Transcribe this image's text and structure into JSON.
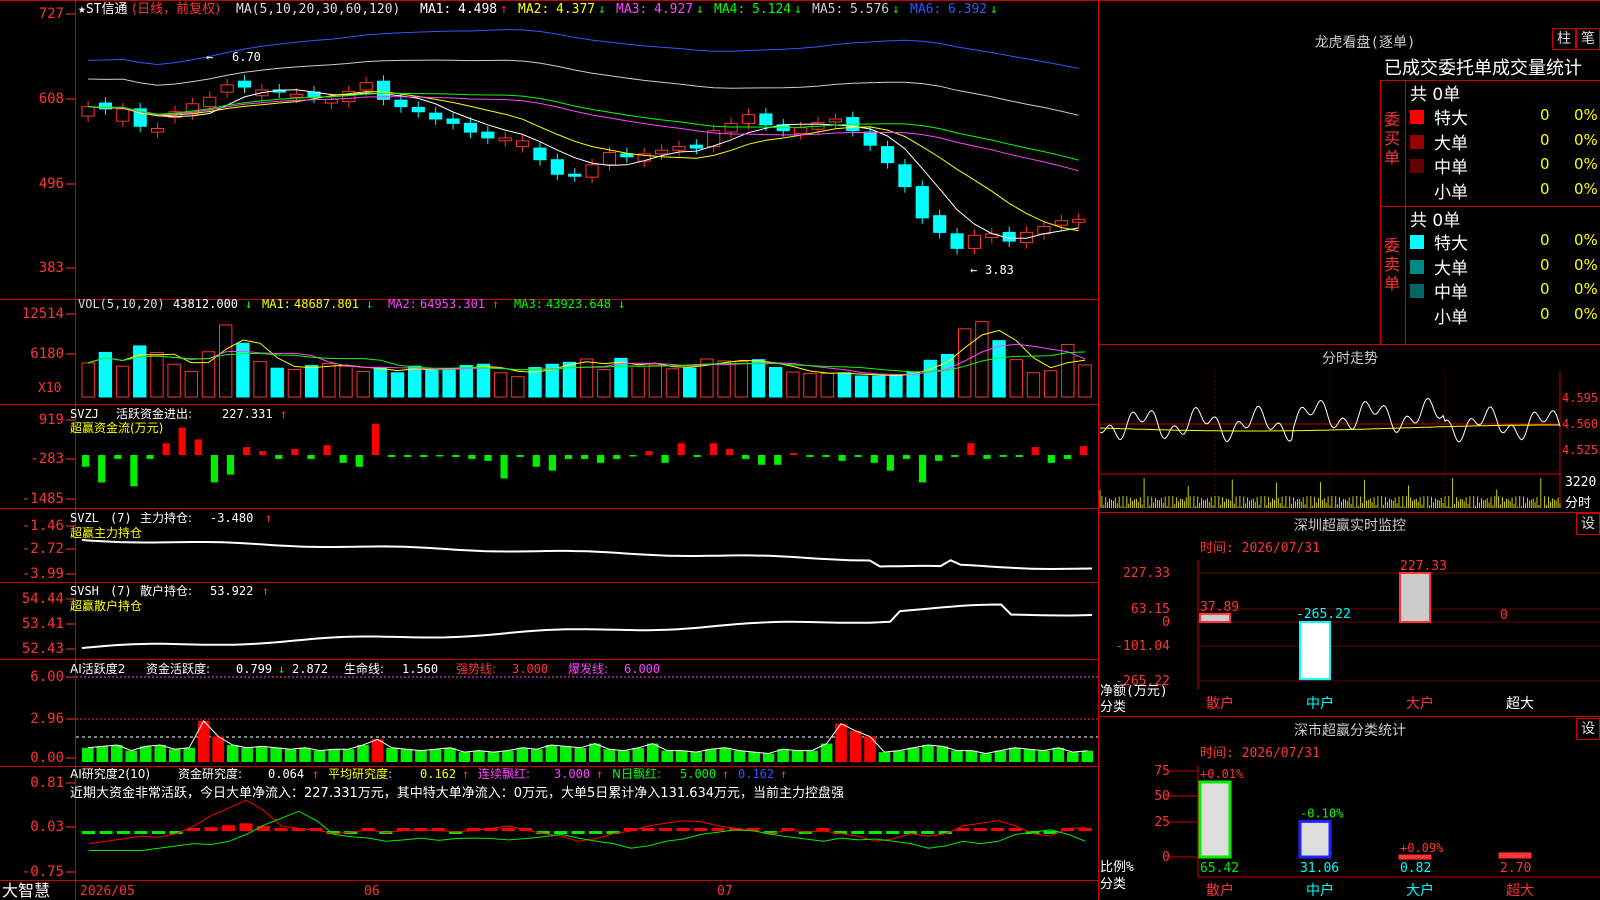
{
  "stock": {
    "name": "★ST信通",
    "period": "(日线，前复权)",
    "ma_label": "MA(5,10,20,30,60,120)",
    "ma": [
      {
        "label": "MA1:",
        "value": "4.498",
        "arrow": "↑",
        "color": "#ffffff"
      },
      {
        "label": "MA2:",
        "value": "4.377",
        "arrow": "↓",
        "color": "#ffff00"
      },
      {
        "label": "MA3:",
        "value": "4.927",
        "arrow": "↓",
        "color": "#ff44ff"
      },
      {
        "label": "MA4:",
        "value": "5.124",
        "arrow": "↓",
        "color": "#00ff00"
      },
      {
        "label": "MA5:",
        "value": "5.576",
        "arrow": "↓",
        "color": "#cccccc"
      },
      {
        "label": "MA6:",
        "value": "6.392",
        "arrow": "↓",
        "color": "#3355ff"
      }
    ],
    "price_ticks": [
      "727",
      "608",
      "496",
      "383"
    ],
    "high_label": "6.70",
    "low_label": "3.83",
    "candles_close": [
      6.05,
      6.02,
      6.02,
      5.78,
      5.75,
      5.98,
      6.09,
      6.18,
      6.35,
      6.32,
      6.28,
      6.25,
      6.22,
      6.18,
      6.15,
      6.26,
      6.38,
      6.15,
      6.05,
      5.98,
      5.88,
      5.82,
      5.7,
      5.62,
      5.62,
      5.58,
      5.32,
      5.12,
      5.1,
      5.25,
      5.42,
      5.36,
      5.4,
      5.45,
      5.5,
      5.48,
      5.72,
      5.82,
      5.94,
      5.8,
      5.72,
      5.76,
      5.83,
      5.88,
      5.72,
      5.52,
      5.28,
      4.95,
      4.52,
      4.32,
      4.1,
      4.28,
      4.3,
      4.2,
      4.32,
      4.4,
      4.48,
      4.5
    ],
    "candles_open": [
      5.92,
      6.1,
      5.85,
      6.02,
      5.7,
      5.9,
      5.95,
      6.05,
      6.25,
      6.4,
      6.2,
      6.28,
      6.18,
      6.25,
      6.1,
      6.12,
      6.28,
      6.4,
      6.14,
      6.04,
      5.96,
      5.88,
      5.82,
      5.7,
      5.58,
      5.5,
      5.48,
      5.32,
      5.12,
      5.08,
      5.25,
      5.4,
      5.3,
      5.4,
      5.45,
      5.52,
      5.5,
      5.7,
      5.82,
      5.95,
      5.8,
      5.68,
      5.74,
      5.84,
      5.9,
      5.7,
      5.5,
      5.25,
      4.95,
      4.55,
      4.3,
      4.1,
      4.25,
      4.32,
      4.18,
      4.3,
      4.42,
      4.46
    ]
  },
  "volume": {
    "label": "VOL(5,10,20)",
    "value": "43812.000",
    "arrow": "↓",
    "ma": [
      {
        "label": "MA1:",
        "value": "48687.801",
        "arrow": "↓",
        "color": "#ffff00"
      },
      {
        "label": "MA2:",
        "value": "64953.301",
        "arrow": "↑",
        "color": "#ff44ff"
      },
      {
        "label": "MA3:",
        "value": "43923.648",
        "arrow": "↓",
        "color": "#00ff00"
      }
    ],
    "ticks": [
      "12514",
      "6180"
    ],
    "unit": "X10",
    "bars": [
      5200,
      6800,
      4700,
      7800,
      6800,
      5000,
      3900,
      6900,
      11000,
      8200,
      5400,
      4400,
      4200,
      4800,
      5100,
      4700,
      3900,
      4500,
      3700,
      4700,
      4100,
      4200,
      4800,
      5000,
      3700,
      3100,
      4500,
      5000,
      5300,
      5800,
      4200,
      5900,
      4700,
      4900,
      4300,
      4400,
      5800,
      5500,
      5400,
      5700,
      4500,
      3800,
      3600,
      3600,
      3700,
      3200,
      3200,
      3400,
      3800,
      5600,
      6500,
      10400,
      11500,
      8600,
      5700,
      3700,
      4000,
      8000,
      4900
    ]
  },
  "svzj": {
    "title": "SVZJ",
    "desc": "活跃资金进出:",
    "value": "227.331",
    "arrow": "↑",
    "sub": "超赢资金流(万元)",
    "ticks": [
      "919",
      "-283",
      "-1485"
    ],
    "values": [
      -300,
      -700,
      -100,
      -800,
      -100,
      300,
      700,
      400,
      -700,
      -500,
      200,
      100,
      -100,
      150,
      -100,
      250,
      -200,
      -300,
      800,
      -50,
      -50,
      -50,
      -20,
      -50,
      -100,
      -150,
      -600,
      -50,
      -300,
      -400,
      -100,
      -100,
      -200,
      -100,
      -20,
      100,
      -200,
      300,
      -50,
      300,
      150,
      -100,
      -250,
      -250,
      50,
      -50,
      -50,
      -150,
      -50,
      -200,
      -400,
      -100,
      -700,
      -150,
      -50,
      300,
      -100,
      -50,
      -50,
      200,
      -200,
      -100,
      227
    ]
  },
  "svzl": {
    "title": "SVZL",
    "param": "(7)",
    "desc": "主力持仓:",
    "value": "-3.480",
    "arrow": "↑",
    "sub": "超赢主力持仓",
    "ticks": [
      "-1.46",
      "-2.72",
      "-3.99"
    ]
  },
  "svsh": {
    "title": "SVSH",
    "param": "(7)",
    "desc": "散户持仓:",
    "value": "53.922",
    "arrow": "↑",
    "sub": "超赢散户持仓",
    "ticks": [
      "54.44",
      "53.41",
      "52.43"
    ]
  },
  "ai1": {
    "title": "AI活跃度2",
    "desc": "资金活跃度:",
    "v1": "0.799",
    "a1": "↓",
    "v2": "2.872",
    "life_label": "生命线:",
    "life": "1.560",
    "strong_label": "强势线:",
    "strong": "3.000",
    "burst_label": "爆发线:",
    "burst": "6.000",
    "ticks": [
      "6.00",
      "2.96",
      "0.00"
    ],
    "values": [
      1.0,
      1.1,
      1.2,
      0.8,
      1.1,
      1.2,
      0.9,
      1.0,
      2.9,
      1.8,
      1.2,
      1.0,
      1.1,
      1.0,
      0.9,
      1.0,
      0.8,
      0.9,
      0.9,
      1.2,
      1.6,
      1.0,
      0.9,
      0.8,
      0.9,
      1.0,
      0.7,
      0.8,
      0.7,
      0.8,
      1.0,
      0.9,
      1.2,
      1.1,
      1.0,
      1.3,
      0.9,
      0.8,
      1.0,
      1.3,
      0.8,
      0.8,
      0.7,
      0.9,
      1.0,
      0.8,
      0.7,
      0.6,
      0.9,
      0.8,
      0.8,
      1.3,
      2.7,
      2.2,
      1.8,
      0.7,
      0.8,
      1.0,
      1.2,
      1.1,
      0.8,
      0.8,
      0.6,
      0.8,
      1.0,
      0.9,
      0.8,
      1.0,
      0.7,
      0.799
    ]
  },
  "ai2": {
    "title": "AI研究度2(10)",
    "desc": "资金研究度:",
    "v1": "0.064",
    "a1": "↑",
    "avg_label": "平均研究度:",
    "avg": "0.162",
    "a2": "↑",
    "streak_label": "连续飘红:",
    "streak": "3.000",
    "a3": "↑",
    "nday_label": "N日飘红:",
    "nday": "5.000",
    "a4": "↑",
    "v5": "0.162",
    "a5": "↑",
    "summary": "近期大资金非常活跃，今日大单净流入：227.331万元，其中特大单净流入：0万元，大单5日累计净入131.634万元，当前主力控盘强",
    "ticks": [
      "0.81",
      "0.03",
      "-0.75"
    ],
    "values": [
      -0.25,
      -0.2,
      -0.15,
      -0.1,
      -0.12,
      -0.05,
      0.1,
      0.3,
      0.45,
      0.6,
      0.4,
      0.1,
      0.05,
      0.02,
      -0.05,
      -0.02,
      0.02,
      -0.03,
      0.01,
      0.02,
      0.01,
      -0.02,
      0.01,
      0.05,
      0.1,
      0.02,
      -0.05,
      -0.1,
      -0.2,
      -0.15,
      -0.05,
      0.0,
      0.1,
      0.15,
      0.2,
      0.18,
      0.1,
      0.05,
      0.0,
      -0.05,
      0.02,
      -0.02,
      0.0,
      -0.05,
      -0.1,
      -0.2,
      -0.15,
      -0.05,
      -0.1,
      -0.05,
      0.1,
      0.15,
      0.2,
      0.1,
      -0.05,
      -0.1,
      0.05,
      0.064
    ]
  },
  "xaxis": {
    "labels": [
      "2026/05",
      "06",
      "07"
    ]
  },
  "brand": "大智慧",
  "right": {
    "lhkp_title": "龙虎看盘(逐单)",
    "btn_zhu": "柱",
    "btn_bi": "笔",
    "order_header": "已成交委托单成交量统计",
    "buy_label": "委买单",
    "sell_label": "委卖单",
    "buy_total": "共 0单",
    "sell_total": "共 0单",
    "buy_rows": [
      {
        "name": "特大",
        "count": "0",
        "pct": "0%",
        "color": "#ff0000"
      },
      {
        "name": "大单",
        "count": "0",
        "pct": "0%",
        "color": "#990000"
      },
      {
        "name": "中单",
        "count": "0",
        "pct": "0%",
        "color": "#660000"
      },
      {
        "name": "小单",
        "count": "0",
        "pct": "0%",
        "color": ""
      }
    ],
    "sell_rows": [
      {
        "name": "特大",
        "count": "0",
        "pct": "0%",
        "color": "#00ffff"
      },
      {
        "name": "大单",
        "count": "0",
        "pct": "0%",
        "color": "#008888"
      },
      {
        "name": "中单",
        "count": "0",
        "pct": "0%",
        "color": "#006666"
      },
      {
        "name": "小单",
        "count": "0",
        "pct": "0%",
        "color": ""
      }
    ],
    "fs_title": "分时走势",
    "fs_ticks": [
      "4.595",
      "4.560",
      "4.525"
    ],
    "fs_vol": "3220",
    "fs_vol_label": "分时",
    "sz_title": "深圳超赢实时监控",
    "sz_btn": "设",
    "sz_time": "时间: 2026/07/31",
    "sz_ticks": [
      "227.33",
      "63.15",
      "0",
      "-101.04",
      "-265.22"
    ],
    "sz_ylabel": "净额(万元)",
    "sz_xlabel": "分类",
    "sz_cats": [
      "散户",
      "中户",
      "大户",
      "超大"
    ],
    "sz_values": [
      37.89,
      -265.22,
      227.33,
      0
    ],
    "sz_value_labels": [
      "37.89",
      "-265.22",
      "227.33",
      "0"
    ],
    "ss_title": "深市超赢分类统计",
    "ss_btn": "设",
    "ss_time": "时间: 2026/07/31",
    "ss_ticks": [
      "75",
      "50",
      "25",
      "0"
    ],
    "ss_ylabel": "比例%",
    "ss_xlabel": "分类",
    "ss_cats": [
      "散户",
      "中户",
      "大户",
      "超大"
    ],
    "ss_values": [
      65.42,
      31.06,
      0.82,
      2.7
    ],
    "ss_value_labels": [
      "65.42",
      "31.06",
      "0.82",
      "2.70"
    ],
    "ss_changes": [
      "+0.01%",
      "-0.10%",
      "+0.09%",
      ""
    ]
  }
}
